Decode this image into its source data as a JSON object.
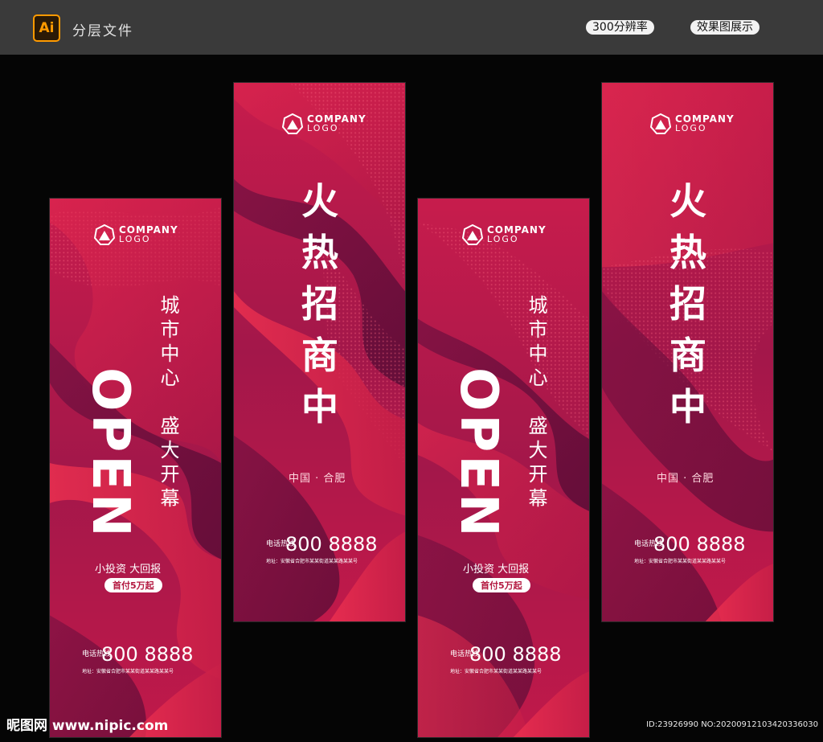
{
  "header": {
    "app_icon": "Ai",
    "title": "分层文件",
    "pill_resolution": "300分辨率",
    "pill_preview": "效果图展示"
  },
  "logo": {
    "company": "COMPANY",
    "sub": "LOGO"
  },
  "open_banner": {
    "open_text": "OPEN",
    "line1": "城市中心",
    "line2": "盛大开幕",
    "slogan": "小投资  大回报",
    "badge": "首付5万起",
    "phone_label": "电话热线",
    "phone": "800 8888",
    "address": "地址：安徽省合肥市某某街道某某路某某号"
  },
  "invest_banner": {
    "title_chars": [
      "火",
      "热",
      "招",
      "商",
      "中"
    ],
    "city": "中国 · 合肥",
    "phone_label": "电话热线",
    "phone": "800 8888",
    "address": "地址：安徽省合肥市某某街道某某路某某号"
  },
  "watermark": {
    "site": "昵图网 www.nipic.com",
    "id": "ID:23926990 NO:20200912103420336030"
  },
  "colors": {
    "top_bar": "#3a3a3a",
    "ai_orange": "#ff9a00",
    "banner_light": "#e0284d",
    "banner_mid": "#b11a48",
    "banner_dark": "#6d0f3e"
  }
}
